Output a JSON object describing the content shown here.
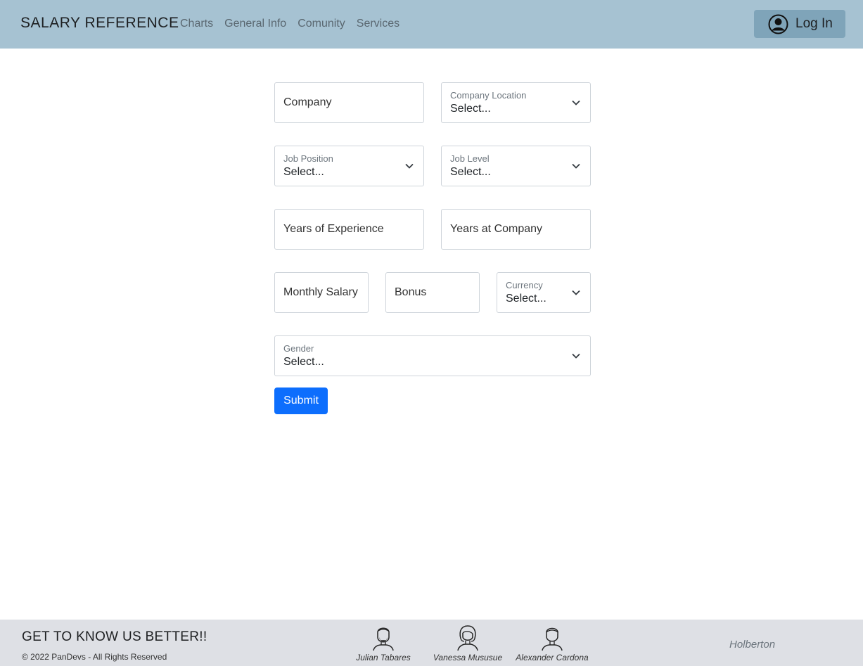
{
  "navbar": {
    "brand": "SALARY REFERENCE",
    "links": [
      "Charts",
      "General Info",
      "Comunity",
      "Services"
    ],
    "login_label": "Log In",
    "login_icon": "user-circle-icon"
  },
  "form": {
    "company": {
      "placeholder": "Company"
    },
    "company_location": {
      "label": "Company Location",
      "value": "Select..."
    },
    "job_position": {
      "label": "Job Position",
      "value": "Select..."
    },
    "job_level": {
      "label": "Job Level",
      "value": "Select..."
    },
    "years_experience": {
      "placeholder": "Years of Experience"
    },
    "years_company": {
      "placeholder": "Years at Company"
    },
    "monthly_salary": {
      "placeholder": "Monthly Salary"
    },
    "bonus": {
      "placeholder": "Bonus"
    },
    "currency": {
      "label": "Currency",
      "value": "Select..."
    },
    "gender": {
      "label": "Gender",
      "value": "Select..."
    },
    "submit_label": "Submit"
  },
  "footer": {
    "title": "GET TO KNOW US BETTER!!",
    "copyright": "© 2022 PanDevs - All Rights Reserved",
    "devs": [
      {
        "name": "Julian Tabares",
        "icon": "bearded-man-avatar-icon"
      },
      {
        "name": "Vanessa Mususue",
        "icon": "woman-avatar-icon"
      },
      {
        "name": "Alexander Cardona",
        "icon": "man-avatar-icon"
      }
    ],
    "school": "Holberton"
  },
  "colors": {
    "navbar_bg": "#a6c2d2",
    "login_bg": "#7fa4b9",
    "submit_bg": "#0d6efd",
    "footer_bg": "#dee0e5"
  }
}
